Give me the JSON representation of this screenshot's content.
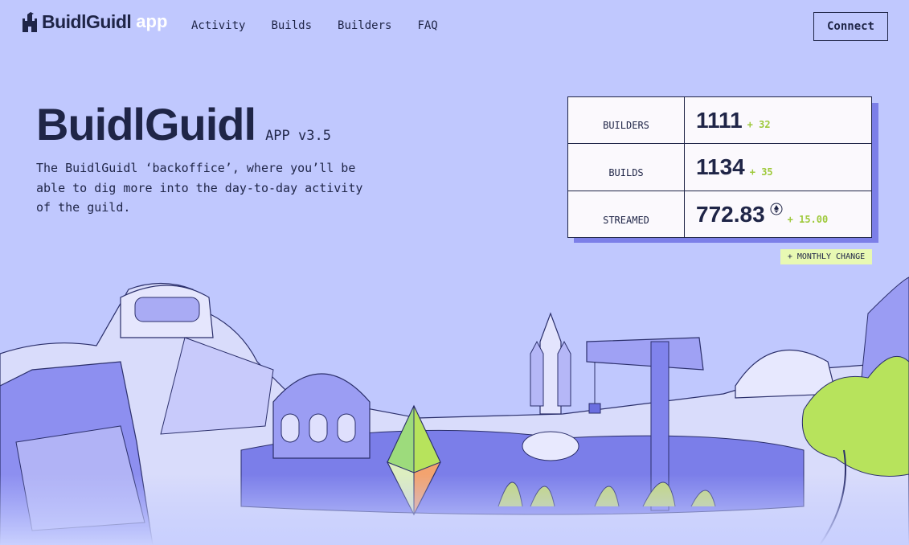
{
  "nav": {
    "logo_text": "BuidlGuidl",
    "logo_suffix": "app",
    "links": [
      "Activity",
      "Builds",
      "Builders",
      "FAQ"
    ],
    "connect_label": "Connect"
  },
  "hero": {
    "title": "BuidlGuidl",
    "version": "APP v3.5",
    "description": "The BuidlGuidl ‘backoffice’, where you’ll be able to dig more into the day-to-day activity of the guild."
  },
  "stats": [
    {
      "label": "BUILDERS",
      "value": "1111",
      "change": "+ 32"
    },
    {
      "label": "BUILDS",
      "value": "1134",
      "change": "+ 35"
    },
    {
      "label": "STREAMED",
      "value": "772.83",
      "change": "+ 15.00",
      "icon": "eth-icon"
    }
  ],
  "monthly_change_label": "+ MONTHLY CHANGE",
  "colors": {
    "background": "#c0c8fe",
    "text": "#1f2547",
    "accent_green": "#9ec93a",
    "card_shadow": "#7c7fe8"
  }
}
